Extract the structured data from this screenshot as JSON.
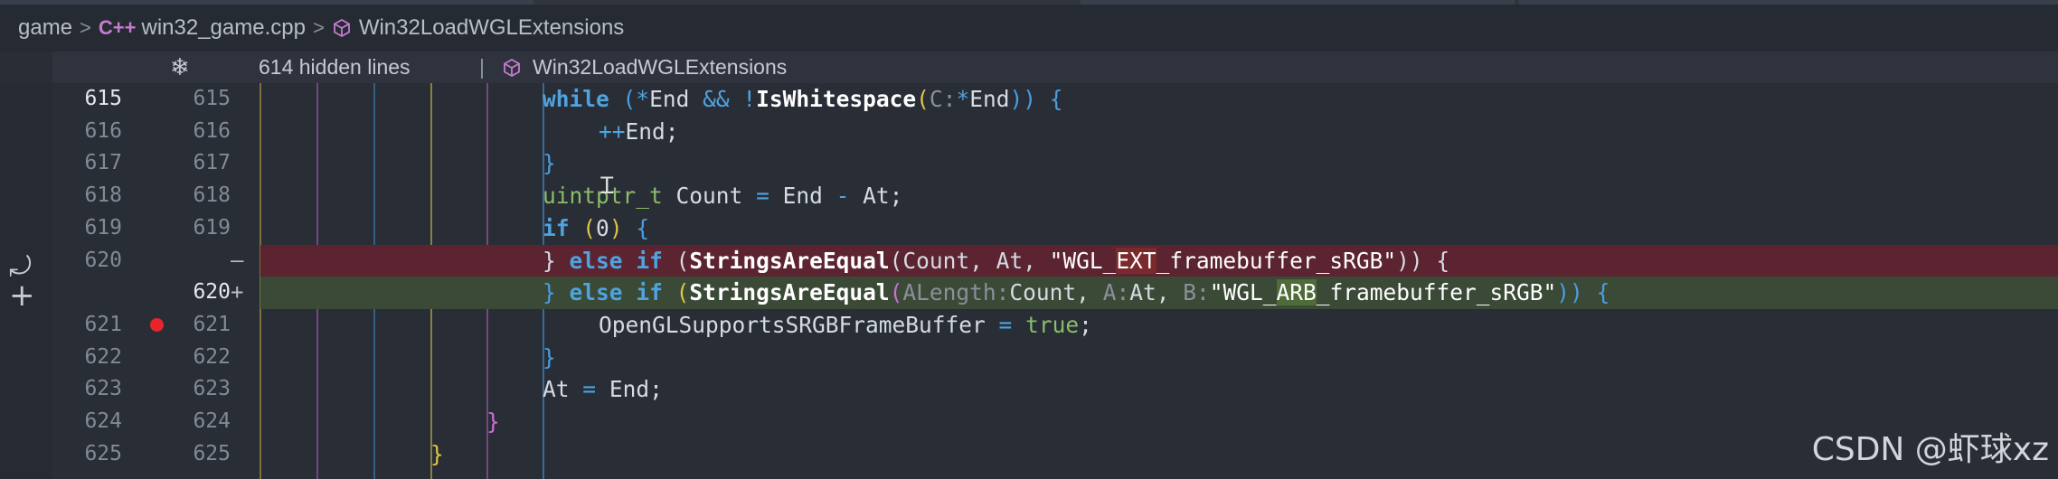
{
  "breadcrumb": {
    "root": "game",
    "file_lang_icon": "C++",
    "file": "win32_game.cpp",
    "symbol": "Win32LoadWGLExtensions"
  },
  "sticky": {
    "icon": "snowflake-icon",
    "hidden_lines": "614 hidden lines",
    "separator": "|",
    "symbol": "Win32LoadWGLExtensions"
  },
  "lines": [
    {
      "a": "615",
      "b": "615"
    },
    {
      "a": "616",
      "b": "616"
    },
    {
      "a": "617",
      "b": "617"
    },
    {
      "a": "618",
      "b": "618"
    },
    {
      "a": "619",
      "b": "619"
    },
    {
      "a": "620",
      "b": "",
      "sign": "—"
    },
    {
      "a": "",
      "b": "620",
      "sign": "+"
    },
    {
      "a": "621",
      "b": "621"
    },
    {
      "a": "622",
      "b": "622"
    },
    {
      "a": "623",
      "b": "623"
    },
    {
      "a": "624",
      "b": "624"
    },
    {
      "a": "625",
      "b": "625"
    }
  ],
  "code": {
    "l615": {
      "kw": "while",
      "p": "(",
      "op1": "*",
      "v1": "End",
      "and": "&&",
      "not": "!",
      "fn": "IsWhitespace",
      "hint": "C:",
      "op2": "*",
      "v2": "End",
      "close": "))",
      "brace": "{"
    },
    "l616": {
      "op": "++",
      "v": "End;"
    },
    "l617": {
      "brace": "}"
    },
    "l618": {
      "ty": "uintptr_t",
      "rest1": "Count",
      "eq": "=",
      "rest2": "End",
      "minus": "-",
      "rest3": "At;"
    },
    "l619": {
      "kw": "if",
      "num": "0",
      "brace": "{"
    },
    "l620d": {
      "brace": "}",
      "kw1": "else",
      "kw2": "if",
      "fn": "StringsAreEqual",
      "args": "(Count, At, ",
      "str_a": "\"WGL_",
      "str_hl": "EXT",
      "str_b": "_framebuffer_sRGB\"",
      "end": ")) {"
    },
    "l620i": {
      "brace": "}",
      "kw1": "else",
      "kw2": "if",
      "fn": "StringsAreEqual",
      "h1": "ALength:",
      "a1": "Count,",
      "h2": "A:",
      "a2": "At,",
      "h3": "B:",
      "str_a": "\"WGL_",
      "str_hl": "ARB",
      "str_b": "_framebuffer_sRGB\"",
      "end": "))",
      "brace2": "{"
    },
    "l621": {
      "v": "OpenGLSupportsSRGBFrameBuffer",
      "eq": "=",
      "kw": "true",
      "semi": ";"
    },
    "l622": {
      "brace": "}"
    },
    "l623": {
      "v1": "At",
      "eq": "=",
      "v2": "End;"
    },
    "l624": {
      "brace": "}"
    },
    "l625": {
      "brace": "}"
    }
  },
  "watermark": "CSDN @虾球xz",
  "colors": {
    "background": "#282d36",
    "deleted_line": "#5b2430",
    "inserted_line": "#3a4a36",
    "keyword": "#4fa3df",
    "breakpoint": "#e8262a"
  }
}
